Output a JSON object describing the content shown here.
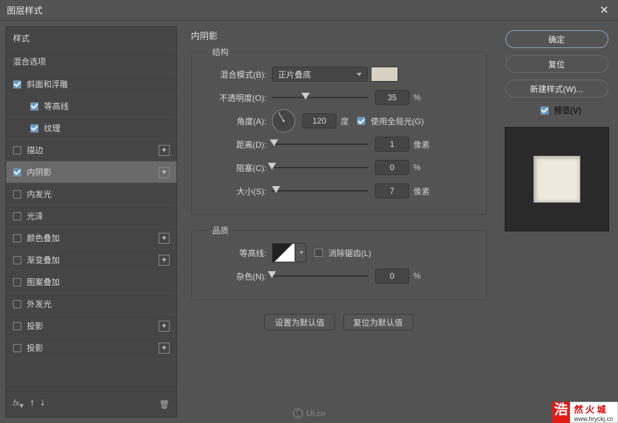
{
  "dialog": {
    "title": "图层样式"
  },
  "sidebar": {
    "styles_header": "样式",
    "blend_header": "混合选项",
    "items": [
      {
        "label": "斜面和浮雕",
        "checked": true,
        "indent": false,
        "has_add": false,
        "selected": false
      },
      {
        "label": "等高线",
        "checked": true,
        "indent": true,
        "has_add": false,
        "selected": false
      },
      {
        "label": "纹理",
        "checked": true,
        "indent": true,
        "has_add": false,
        "selected": false
      },
      {
        "label": "描边",
        "checked": false,
        "indent": false,
        "has_add": true,
        "selected": false
      },
      {
        "label": "内阴影",
        "checked": true,
        "indent": false,
        "has_add": true,
        "selected": true
      },
      {
        "label": "内发光",
        "checked": false,
        "indent": false,
        "has_add": false,
        "selected": false
      },
      {
        "label": "光泽",
        "checked": false,
        "indent": false,
        "has_add": false,
        "selected": false
      },
      {
        "label": "颜色叠加",
        "checked": false,
        "indent": false,
        "has_add": true,
        "selected": false
      },
      {
        "label": "渐变叠加",
        "checked": false,
        "indent": false,
        "has_add": true,
        "selected": false
      },
      {
        "label": "图案叠加",
        "checked": false,
        "indent": false,
        "has_add": false,
        "selected": false
      },
      {
        "label": "外发光",
        "checked": false,
        "indent": false,
        "has_add": false,
        "selected": false
      },
      {
        "label": "投影",
        "checked": false,
        "indent": false,
        "has_add": true,
        "selected": false
      },
      {
        "label": "投影",
        "checked": false,
        "indent": false,
        "has_add": true,
        "selected": false
      }
    ],
    "fx_label": "fx"
  },
  "main": {
    "panel_title": "内阴影",
    "structure": {
      "legend": "结构",
      "blend_mode_label": "混合模式(B):",
      "blend_mode_value": "正片叠底",
      "opacity_label": "不透明度(O):",
      "opacity_value": "35",
      "opacity_unit": "%",
      "angle_label": "角度(A):",
      "angle_value": "120",
      "angle_unit": "度",
      "global_light_label": "使用全局光(G)",
      "distance_label": "距离(D):",
      "distance_value": "1",
      "distance_unit": "像素",
      "choke_label": "阻塞(C):",
      "choke_value": "0",
      "choke_unit": "%",
      "size_label": "大小(S):",
      "size_value": "7",
      "size_unit": "像素"
    },
    "quality": {
      "legend": "品质",
      "contour_label": "等高线:",
      "antialias_label": "消除锯齿(L)",
      "noise_label": "杂色(N):",
      "noise_value": "0",
      "noise_unit": "%"
    },
    "defaults": {
      "make": "设置为默认值",
      "reset": "复位为默认值"
    }
  },
  "right": {
    "ok": "确定",
    "cancel": "复位",
    "new_style": "新建样式(W)...",
    "preview_label": "预览(V)"
  },
  "brand": {
    "char": "浩",
    "name": "然 火 城",
    "url": "www.hryckj.cn"
  },
  "watermark": "UI.cn"
}
